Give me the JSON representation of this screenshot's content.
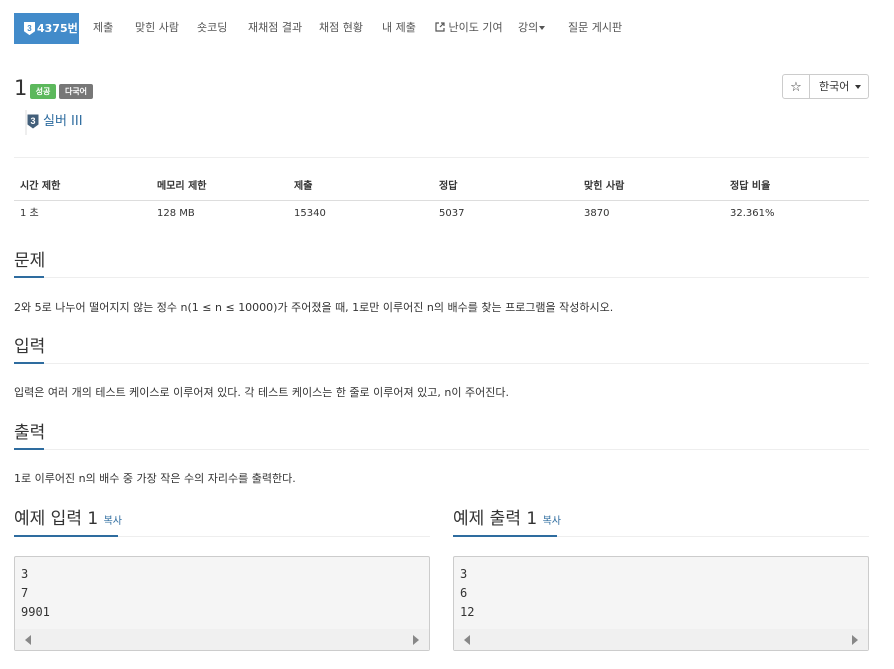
{
  "nav": {
    "problem_id": "4375번",
    "tier_icon": "tier-silver-3-icon",
    "items": [
      "제출",
      "맞힌 사람",
      "숏코딩",
      "재채점 결과",
      "채점 현황",
      "내 제출",
      "난이도 기여",
      "강의",
      "질문 게시판"
    ]
  },
  "problem": {
    "title": "1",
    "labels": [
      "성공",
      "다국어"
    ],
    "tier_num": "3",
    "tier": "실버 III",
    "star": "☆",
    "language": "한국어"
  },
  "info_table": {
    "headers": [
      "시간 제한",
      "메모리 제한",
      "제출",
      "정답",
      "맞힌 사람",
      "정답 비율"
    ],
    "values": [
      "1 초",
      "128 MB",
      "15340",
      "5037",
      "3870",
      "32.361%"
    ]
  },
  "sections": {
    "problem": {
      "title": "문제",
      "text": "2와 5로 나누어 떨어지지 않는 정수 n(1 ≤ n ≤ 10000)가 주어졌을 때, 1로만 이루어진 n의 배수를 찾는 프로그램을 작성하시오."
    },
    "input": {
      "title": "입력",
      "text": "입력은 여러 개의 테스트 케이스로 이루어져 있다. 각 테스트 케이스는 한 줄로 이루어져 있고, n이 주어진다."
    },
    "output": {
      "title": "출력",
      "text": "1로 이루어진 n의 배수 중 가장 작은 수의 자리수를 출력한다."
    }
  },
  "samples": {
    "input_title": "예제 입력 1",
    "output_title": "예제 출력 1",
    "copy_label": "복사",
    "input_lines": [
      "3",
      "7",
      "9901"
    ],
    "output_lines": [
      "3",
      "6",
      "12"
    ]
  },
  "colors": {
    "primary": "#428bca",
    "success": "#5cb85c",
    "multilang": "#777777",
    "link": "#2e6c9f"
  }
}
